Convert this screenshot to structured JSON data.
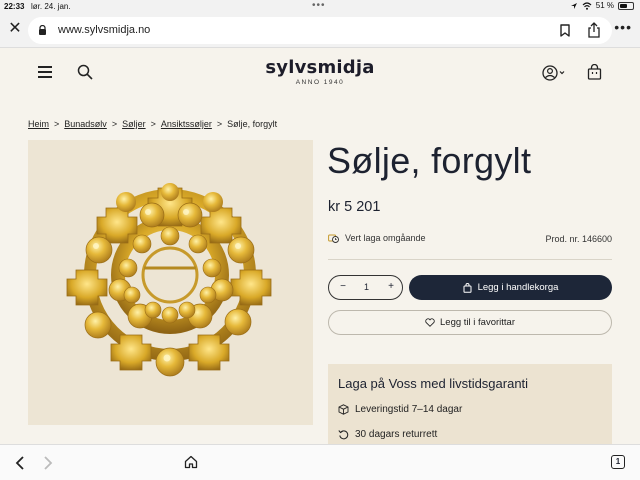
{
  "status_bar": {
    "time": "22:33",
    "date": "lør. 24. jan.",
    "battery": "51 %"
  },
  "browser": {
    "url": "www.sylvsmidja.no",
    "icons": [
      "close-icon",
      "lock-icon",
      "bookmark-icon",
      "share-icon",
      "more-icon"
    ]
  },
  "site": {
    "logo_name": "sylvsmidja",
    "logo_tagline": "ANNO 1940"
  },
  "breadcrumb": {
    "items": [
      "Heim",
      "Bunadsølv",
      "Søljer",
      "Ansiktssøljer"
    ],
    "current": "Sølje, forgylt",
    "separator": ">"
  },
  "product": {
    "title": "Sølje, forgylt",
    "price": "kr 5 201",
    "availability": "Vert laga omgåande",
    "product_number": "Prod. nr. 146600",
    "quantity": "1",
    "add_to_cart": "Legg i handlekorga",
    "add_to_favorites": "Legg til i favorittar"
  },
  "guarantee": {
    "title": "Laga på Voss med livstidsgaranti",
    "features": [
      "Leveringstid 7–14 dagar",
      "30 dagars returrett"
    ]
  },
  "bottom_bar": {
    "tab_count": "1"
  },
  "colors": {
    "page_bg": "#f6f3ec",
    "primary_button": "#1d2638",
    "image_bg": "#ede5d4",
    "guarantee_bg": "#ece3d1",
    "gold": "#d9a928"
  }
}
